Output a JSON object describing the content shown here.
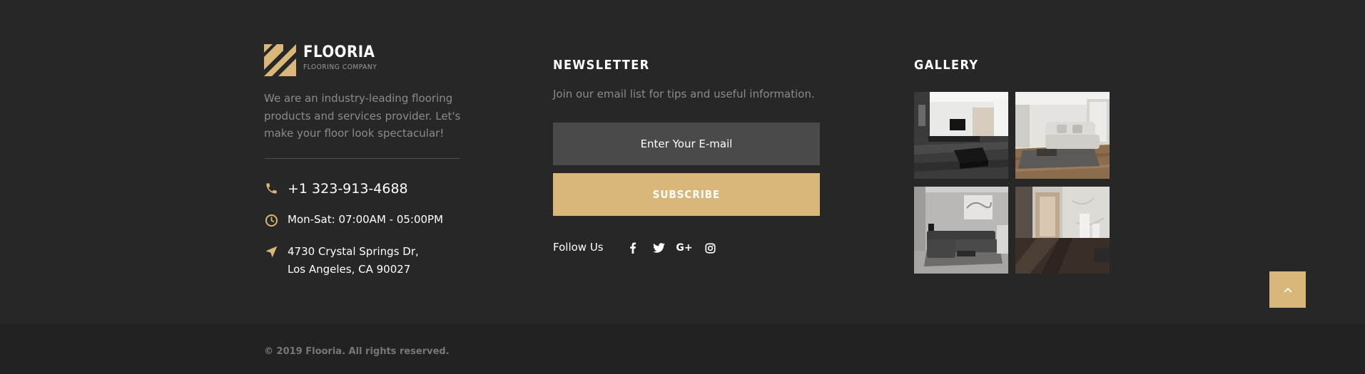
{
  "brand": {
    "name": "FLOORIA",
    "tagline": "FLOORING COMPANY",
    "accent_color": "#d9b679"
  },
  "about": {
    "text": "We are an industry-leading flooring products and services provider. Let's make your floor look spectacular!"
  },
  "contact": {
    "phone": "+1 323-913-4688",
    "hours": "Mon-Sat: 07:00AM - 05:00PM",
    "address_line1": "4730 Crystal Springs Dr,",
    "address_line2": "Los Angeles, CA 90027",
    "icons": [
      "phone-icon",
      "clock-icon",
      "location-arrow-icon"
    ]
  },
  "newsletter": {
    "title": "NEWSLETTER",
    "description": "Join our email list for tips and useful information.",
    "email_placeholder": "Enter Your E-mail",
    "subscribe_label": "SUBSCRIBE",
    "follow_label": "Follow Us",
    "social": [
      "facebook-icon",
      "twitter-icon",
      "google-plus-icon",
      "instagram-icon"
    ]
  },
  "gallery": {
    "title": "GALLERY",
    "images": [
      "gallery-image-1",
      "gallery-image-2",
      "gallery-image-3",
      "gallery-image-4"
    ]
  },
  "back_to_top_icon": "chevron-up-icon",
  "copyright": "© 2019 Flooria. All rights reserved."
}
